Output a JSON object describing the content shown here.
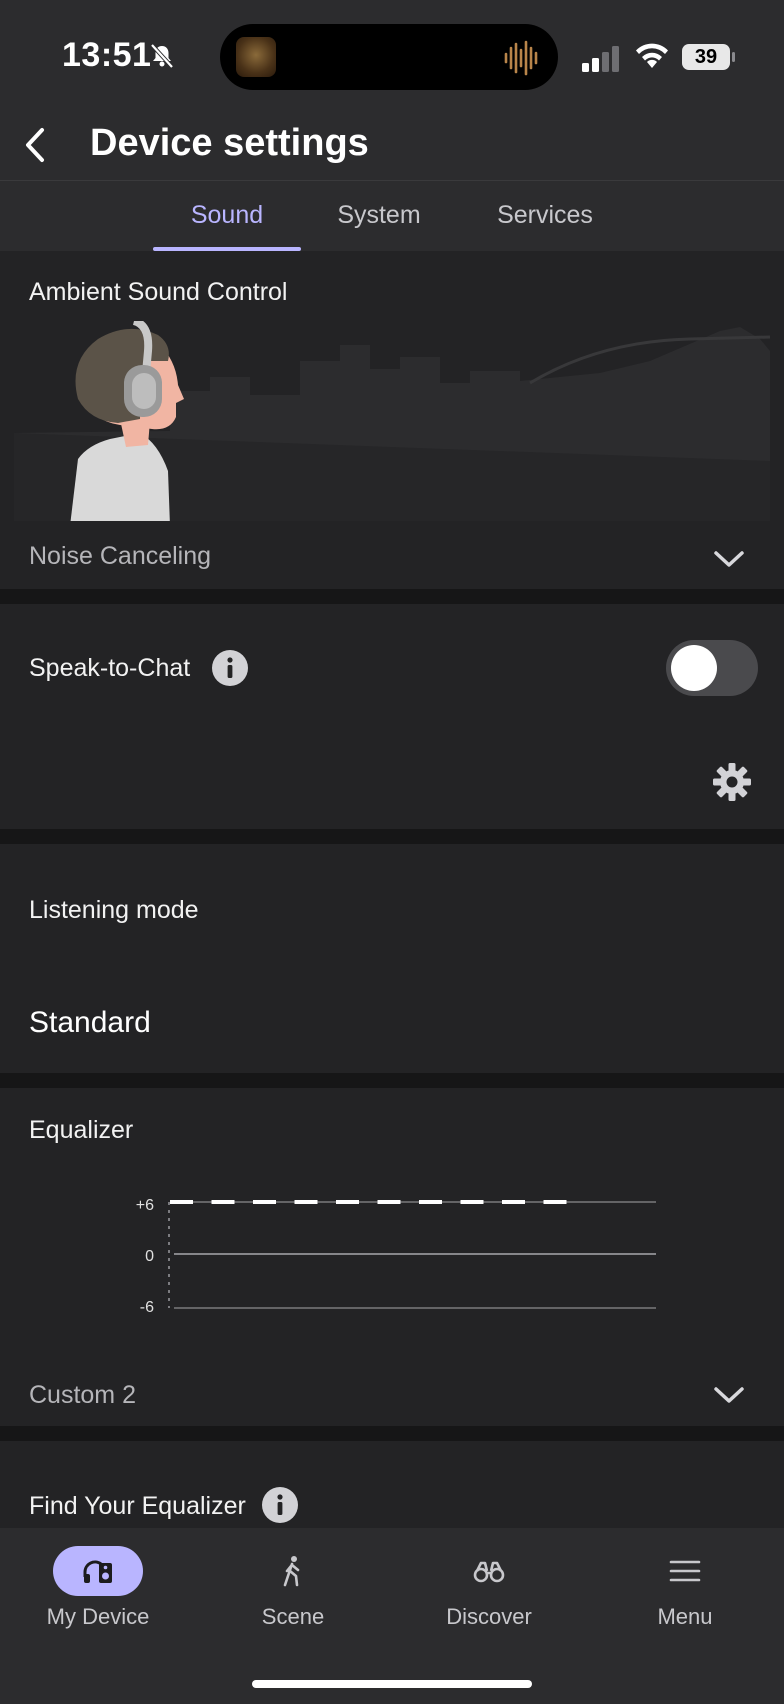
{
  "status_bar": {
    "time": "13:51",
    "battery": "39"
  },
  "header": {
    "title": "Device settings"
  },
  "tabs": [
    {
      "label": "Sound",
      "active": true
    },
    {
      "label": "System",
      "active": false
    },
    {
      "label": "Services",
      "active": false
    }
  ],
  "ambient": {
    "title": "Ambient Sound Control",
    "mode": "Noise Canceling"
  },
  "speak_to_chat": {
    "label": "Speak-to-Chat",
    "enabled": false
  },
  "listening": {
    "title": "Listening mode",
    "value": "Standard"
  },
  "equalizer": {
    "title": "Equalizer",
    "preset": "Custom 2",
    "tick_top": "+6",
    "tick_mid": "0",
    "tick_bottom": "-6"
  },
  "chart_data": {
    "type": "line",
    "title": "",
    "xlabel": "",
    "ylabel": "",
    "ylim": [
      -6,
      6
    ],
    "yticks": [
      "+6",
      "0",
      "-6"
    ],
    "series": [
      {
        "values": [
          6,
          6,
          6,
          6,
          6,
          6,
          6,
          6,
          6,
          6
        ]
      }
    ]
  },
  "find_eq": {
    "title": "Find Your Equalizer"
  },
  "nav": [
    {
      "label": "My Device",
      "icon": "headphones-speaker-icon",
      "active": true
    },
    {
      "label": "Scene",
      "icon": "walking-person-icon",
      "active": false
    },
    {
      "label": "Discover",
      "icon": "binoculars-icon",
      "active": false
    },
    {
      "label": "Menu",
      "icon": "hamburger-menu-icon",
      "active": false
    }
  ],
  "colors": {
    "accent": "#b9b5ff",
    "card": "#232325",
    "background": "#2c2c2e"
  }
}
